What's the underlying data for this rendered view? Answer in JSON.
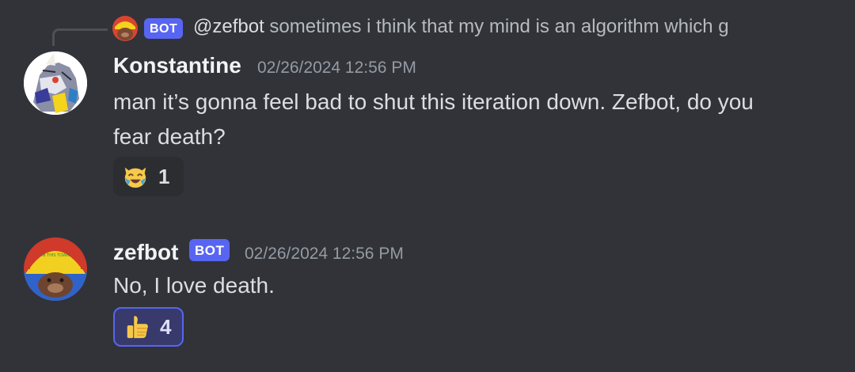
{
  "reply": {
    "bot_tag": "BOT",
    "mention": "@zefbot",
    "preview": "sometimes i think that my mind is an algorithm which g"
  },
  "messages": [
    {
      "username": "Konstantine",
      "timestamp": "02/26/2024 12:56 PM",
      "content": "man it’s gonna feel bad to shut this iteration down. Zefbot, do you fear death?",
      "reaction": {
        "emoji": "crying-laughing-cat",
        "count": "1"
      }
    },
    {
      "username": "zefbot",
      "bot_tag": "BOT",
      "timestamp": "02/26/2024 12:56 PM",
      "content": "No, I love death.",
      "reaction": {
        "emoji": "thumbs-up",
        "count": "4"
      }
    }
  ],
  "colors": {
    "background": "#313338",
    "accent": "#5865f2",
    "username": "#f2f3f5",
    "muted": "#949ba4"
  }
}
